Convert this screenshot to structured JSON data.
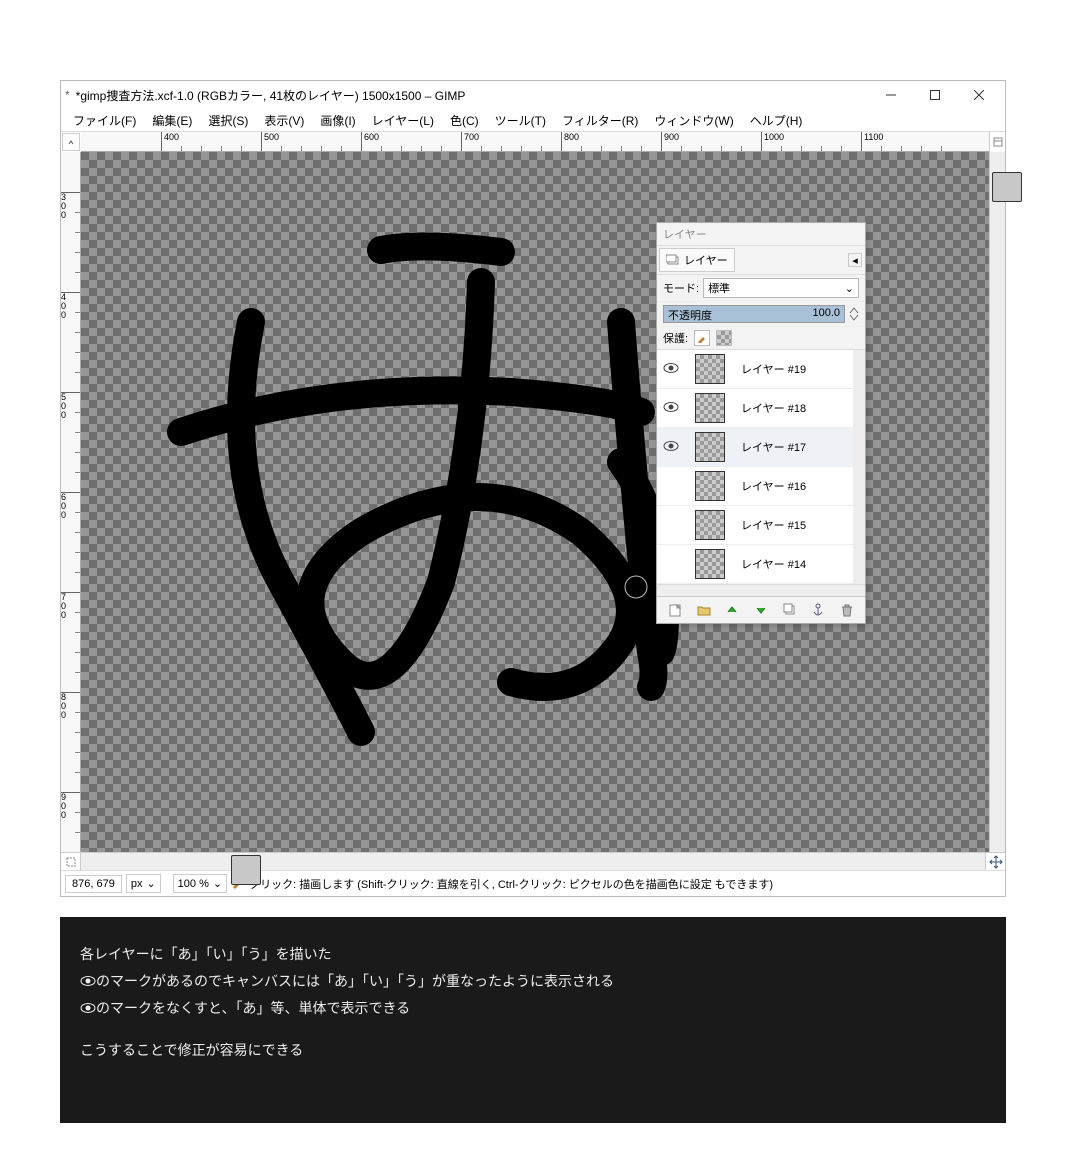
{
  "title": "*gimp捜査方法.xcf-1.0 (RGBカラー, 41枚のレイヤー) 1500x1500 – GIMP",
  "menu": {
    "file": "ファイル(F)",
    "edit": "編集(E)",
    "select": "選択(S)",
    "view": "表示(V)",
    "image": "画像(I)",
    "layer": "レイヤー(L)",
    "color": "色(C)",
    "tools": "ツール(T)",
    "filter": "フィルター(R)",
    "window": "ウィンドウ(W)",
    "help": "ヘルプ(H)"
  },
  "ruler_h": [
    "400",
    "500",
    "600",
    "700",
    "800",
    "900",
    "1000",
    "1100"
  ],
  "ruler_v": [
    "300",
    "400",
    "500",
    "600",
    "700",
    "800",
    "900"
  ],
  "layers": {
    "title": "レイヤー",
    "tab_label": "レイヤー",
    "mode_label": "モード:",
    "mode_value": "標準",
    "opacity_label": "不透明度",
    "opacity_value": "100.0",
    "lock_label": "保護:",
    "items": [
      {
        "visible": true,
        "name": "レイヤー #19"
      },
      {
        "visible": true,
        "name": "レイヤー #18"
      },
      {
        "visible": true,
        "name": "レイヤー #17",
        "selected": true
      },
      {
        "visible": false,
        "name": "レイヤー #16"
      },
      {
        "visible": false,
        "name": "レイヤー #15"
      },
      {
        "visible": false,
        "name": "レイヤー #14"
      }
    ]
  },
  "status": {
    "coords": "876, 679",
    "unit": "px",
    "zoom": "100 %",
    "hint": "クリック: 描画します (Shift-クリック: 直線を引く, Ctrl-クリック: ピクセルの色を描画色に設定 もできます)"
  },
  "caption": {
    "l1": "各レイヤーに「あ」「い」「う」を描いた",
    "l2a": "のマークがあるのでキャンバスには「あ」「い」「う」が重なったように表示される",
    "l3a": "のマークをなくすと、「あ」等、単体で表示できる",
    "l4": "こうすることで修正が容易にできる"
  }
}
